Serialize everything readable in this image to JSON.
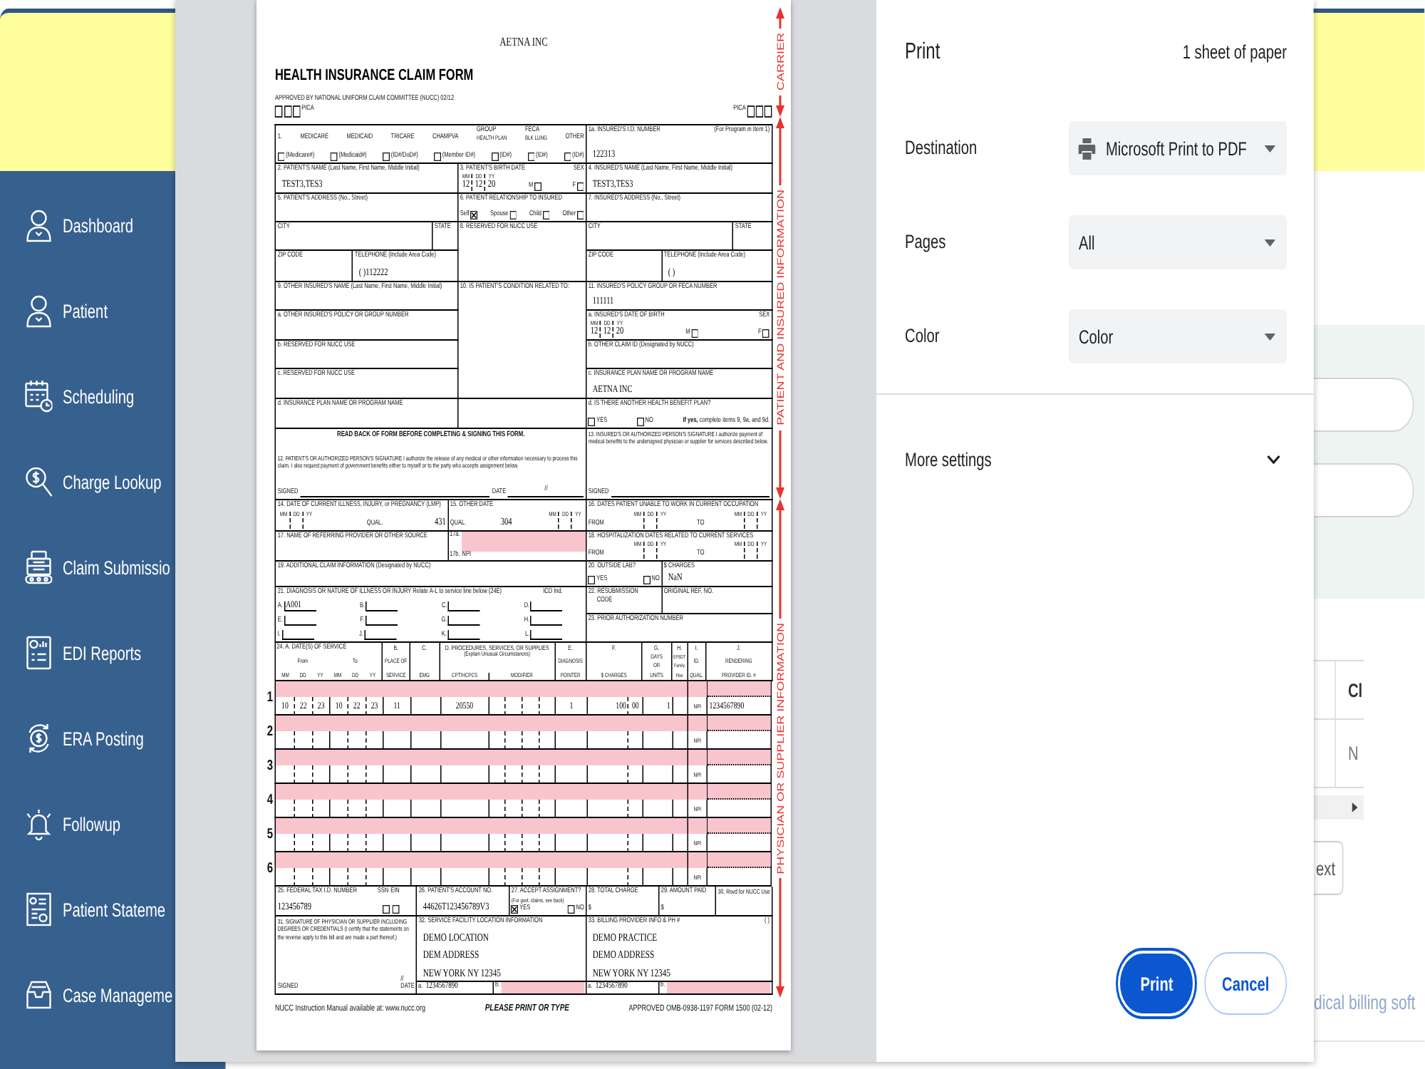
{
  "app": {
    "sidebar": [
      {
        "label": "Dashboard"
      },
      {
        "label": "Patient"
      },
      {
        "label": "Scheduling"
      },
      {
        "label": "Charge Lookup"
      },
      {
        "label": "Claim Submissio"
      },
      {
        "label": "EDI Reports"
      },
      {
        "label": "ERA Posting"
      },
      {
        "label": "Followup"
      },
      {
        "label": "Patient Stateme"
      },
      {
        "label": "Case Manageme"
      }
    ],
    "page": {
      "table_header": "Cl",
      "table_cell": "N",
      "button": "ext",
      "footer": "dical billing soft"
    }
  },
  "print_dialog": {
    "preview": {
      "payer": "AETNA INC",
      "title": "HEALTH INSURANCE CLAIM FORM",
      "approval": "APPROVED BY NATIONAL UNIFORM CLAIM COMMITTEE (NUCC) 02/12",
      "pica": [
        {
          "label": "PICA",
          "boxes": [
            {
              "checked": false
            },
            {
              "checked": false
            },
            {
              "checked": false
            }
          ]
        },
        {
          "label": "PICA",
          "boxes": [
            {
              "checked": false
            },
            {
              "checked": false
            },
            {
              "checked": false
            }
          ]
        }
      ],
      "upper": [
        {
          "lines": [
            [
              {
                "kind": "caption",
                "text": "1."
              },
              {
                "kind": "caption",
                "text": "MEDICARE"
              },
              {
                "kind": "caption",
                "text": "MEDICAID"
              },
              {
                "kind": "caption",
                "text": "TRICARE"
              },
              {
                "kind": "caption",
                "text": "CHAMPVA"
              },
              {
                "kind": "caption",
                "text": "GROUP",
                "sub": "HEALTH PLAN"
              },
              {
                "kind": "caption",
                "text": "FECA",
                "sub": "BLK LUNG"
              },
              {
                "kind": "caption",
                "text": "OTHER"
              }
            ],
            [
              {
                "kind": "check",
                "checked": false,
                "label": "(Medicare#)"
              },
              {
                "kind": "check",
                "checked": false,
                "label": "(Medicaid#)"
              },
              {
                "kind": "check",
                "checked": false,
                "label": "(ID#/DoD#)"
              },
              {
                "kind": "check",
                "checked": false,
                "label": "(Member ID#)"
              },
              {
                "kind": "check",
                "checked": false,
                "label": "(ID#)"
              },
              {
                "kind": "check",
                "checked": false,
                "label": "(ID#)"
              },
              {
                "kind": "check",
                "checked": false,
                "label": "(ID#)"
              }
            ]
          ]
        },
        {
          "lines": [
            [
              {
                "kind": "caption",
                "text": "1a. INSURED'S I.D. NUMBER"
              },
              {
                "kind": "caption",
                "text": "(For Program in Item 1)"
              }
            ],
            [
              {
                "kind": "value",
                "text": "122313"
              }
            ]
          ]
        },
        {
          "lines": [
            [
              {
                "kind": "caption",
                "text": "2. PATIENT'S NAME (Last Name, First Name, Middle Initial)"
              }
            ],
            [
              {
                "kind": "value",
                "text": "TEST3,TES3"
              }
            ]
          ]
        },
        {
          "lines": [
            [
              {
                "kind": "caption",
                "text": "3. PATIENT'S BIRTH DATE"
              },
              {
                "kind": "caption",
                "text": "SEX"
              }
            ],
            [
              {
                "kind": "date",
                "parts": [
                  {
                    "unit": "MM",
                    "value": "12"
                  },
                  {
                    "unit": "DD",
                    "value": "12"
                  },
                  {
                    "unit": "YY",
                    "value": "20"
                  }
                ]
              },
              {
                "kind": "check",
                "checked": false,
                "prefix": "M"
              },
              {
                "kind": "check",
                "checked": false,
                "prefix": "F"
              }
            ]
          ]
        },
        {
          "lines": [
            [
              {
                "kind": "caption",
                "text": "4. INSURED'S NAME (Last Name, First Name, Middle Initial)"
              }
            ],
            [
              {
                "kind": "value",
                "text": "TEST3,TES3"
              }
            ]
          ]
        },
        {
          "lines": [
            [
              {
                "kind": "caption",
                "text": "5. PATIENT'S ADDRESS (No., Street)"
              }
            ]
          ]
        },
        {
          "lines": [
            [
              {
                "kind": "caption",
                "text": "6. PATIENT RELATIONSHIP TO INSURED"
              }
            ],
            [
              {
                "kind": "check",
                "checked": true,
                "prefix": "Self"
              },
              {
                "kind": "check",
                "checked": false,
                "prefix": "Spouse"
              },
              {
                "kind": "check",
                "checked": false,
                "prefix": "Child"
              },
              {
                "kind": "check",
                "checked": false,
                "prefix": "Other"
              }
            ]
          ]
        },
        {
          "lines": [
            [
              {
                "kind": "caption",
                "text": "7. INSURED'S ADDRESS (No., Street)"
              }
            ]
          ]
        },
        {
          "lines": [
            [
              {
                "kind": "caption",
                "text": "CITY"
              }
            ]
          ]
        },
        {
          "lines": [
            [
              {
                "kind": "caption",
                "text": "STATE"
              }
            ]
          ]
        },
        {
          "lines": [
            [
              {
                "kind": "caption",
                "text": "8. RESERVED FOR NUCC USE"
              }
            ]
          ]
        },
        {
          "lines": [
            [
              {
                "kind": "caption",
                "text": "CITY"
              }
            ]
          ]
        },
        {
          "lines": [
            [
              {
                "kind": "caption",
                "text": "STATE"
              }
            ]
          ]
        },
        {
          "lines": [
            [
              {
                "kind": "caption",
                "text": "ZIP CODE"
              }
            ]
          ]
        },
        {
          "lines": [
            [
              {
                "kind": "caption",
                "text": "TELEPHONE (Include Area Code)"
              }
            ],
            [
              {
                "kind": "value",
                "text": "( )112222"
              }
            ]
          ]
        },
        {
          "lines": [
            [
              {
                "kind": "caption",
                "text": "ZIP CODE"
              }
            ]
          ]
        },
        {
          "lines": [
            [
              {
                "kind": "caption",
                "text": "TELEPHONE (Include Area Code)"
              }
            ],
            [
              {
                "kind": "value",
                "text": "( )"
              }
            ]
          ]
        },
        {
          "lines": [
            [
              {
                "kind": "caption",
                "text": "9. OTHER INSURED'S NAME (Last Name, First Name, Middle Initial)"
              }
            ]
          ]
        },
        {
          "lines": [
            [
              {
                "kind": "caption",
                "text": "10. IS PATIENT'S CONDITION RELATED TO:"
              }
            ]
          ]
        },
        {
          "lines": [
            [
              {
                "kind": "caption",
                "text": "11. INSURED'S POLICY GROUP OR FECA NUMBER"
              }
            ],
            [
              {
                "kind": "value",
                "text": "111111"
              }
            ]
          ]
        },
        {
          "lines": [
            [
              {
                "kind": "caption",
                "text": "a. OTHER INSURED'S POLICY OR GROUP NUMBER"
              }
            ]
          ]
        },
        {
          "lines": [
            [
              {
                "kind": "caption",
                "text": "a. INSURED'S DATE OF BIRTH"
              },
              {
                "kind": "caption",
                "text": "SEX"
              }
            ],
            [
              {
                "kind": "date",
                "parts": [
                  {
                    "unit": "MM",
                    "value": "12"
                  },
                  {
                    "unit": "DD",
                    "value": "12"
                  },
                  {
                    "unit": "YY",
                    "value": "20"
                  }
                ]
              },
              {
                "kind": "check",
                "checked": false,
                "prefix": "M"
              },
              {
                "kind": "check",
                "checked": false,
                "prefix": "F"
              }
            ]
          ]
        },
        {
          "lines": [
            [
              {
                "kind": "caption",
                "text": "b. RESERVED FOR NUCC USE"
              }
            ]
          ]
        },
        {
          "lines": [
            [
              {
                "kind": "caption",
                "text": "b. OTHER CLAIM ID (Designated by NUCC)"
              }
            ]
          ]
        },
        {
          "lines": [
            [
              {
                "kind": "caption",
                "text": "c. RESERVED FOR NUCC USE"
              }
            ]
          ]
        },
        {
          "lines": [
            [
              {
                "kind": "caption",
                "text": "c. INSURANCE PLAN NAME OR PROGRAM NAME"
              }
            ],
            [
              {
                "kind": "value",
                "text": "AETNA INC"
              }
            ]
          ]
        },
        {
          "lines": [
            [
              {
                "kind": "caption",
                "text": "d. INSURANCE PLAN NAME OR PROGRAM NAME"
              }
            ]
          ]
        },
        {
          "lines": [
            [
              {
                "kind": "caption",
                "text": "d. IS THERE ANOTHER HEALTH BENEFIT PLAN?"
              }
            ],
            [
              {
                "kind": "check",
                "checked": false,
                "label": "YES"
              },
              {
                "kind": "check",
                "checked": false,
                "label": "NO"
              },
              {
                "kind": "caption",
                "text": "**If yes,** complete items 9, 9a, and 9d."
              }
            ]
          ]
        },
        {
          "lines": [
            [
              {
                "kind": "heading",
                "text": "READ BACK OF FORM BEFORE COMPLETING & SIGNING THIS FORM."
              }
            ],
            [
              {
                "kind": "para",
                "text": "12. PATIENT'S OR AUTHORIZED PERSON'S SIGNATURE I authorize the release of any medical or other information necessary to process this claim. I also request payment of government benefits either to myself or to the party who accepts assignment below."
              }
            ],
            [
              {
                "kind": "caption",
                "text": "SIGNED"
              },
              {
                "kind": "blank"
              },
              {
                "kind": "caption",
                "text": "DATE"
              },
              {
                "kind": "blank",
                "value": "//"
              }
            ]
          ]
        },
        {
          "lines": [
            [
              {
                "kind": "para",
                "text": "13. INSURED'S OR AUTHORIZED PERSON'S SIGNATURE I authorize payment of medical benefits to the undersigned physician or supplier for services described below."
              }
            ],
            [
              {
                "kind": "caption",
                "text": "SIGNED"
              },
              {
                "kind": "blank"
              }
            ]
          ]
        },
        {
          "lines": [
            [
              {
                "kind": "caption",
                "text": "14. DATE OF CURRENT ILLNESS, INJURY, or PREGNANCY (LMP)"
              }
            ],
            [
              {
                "kind": "date",
                "parts": [
                  {
                    "unit": "MM"
                  },
                  {
                    "unit": "DD"
                  },
                  {
                    "unit": "YY"
                  }
                ]
              },
              {
                "kind": "caption",
                "text": "QUAL."
              },
              {
                "kind": "value",
                "text": "431"
              }
            ]
          ]
        },
        {
          "lines": [
            [
              {
                "kind": "caption",
                "text": "15. OTHER DATE"
              }
            ],
            [
              {
                "kind": "caption",
                "text": "QUAL."
              },
              {
                "kind": "value",
                "text": "304"
              },
              {
                "kind": "date",
                "parts": [
                  {
                    "unit": "MM"
                  },
                  {
                    "unit": "DD"
                  },
                  {
                    "unit": "YY"
                  }
                ]
              }
            ]
          ]
        },
        {
          "lines": [
            [
              {
                "kind": "caption",
                "text": "16. DATES PATIENT UNABLE TO WORK IN CURRENT OCCUPATION"
              }
            ],
            [
              {
                "kind": "caption",
                "text": "FROM"
              },
              {
                "kind": "date",
                "parts": [
                  {
                    "unit": "MM"
                  },
                  {
                    "unit": "DD"
                  },
                  {
                    "unit": "YY"
                  }
                ]
              },
              {
                "kind": "caption",
                "text": "TO"
              },
              {
                "kind": "date",
                "parts": [
                  {
                    "unit": "MM"
                  },
                  {
                    "unit": "DD"
                  },
                  {
                    "unit": "YY"
                  }
                ]
              }
            ]
          ]
        },
        {
          "lines": [
            [
              {
                "kind": "caption",
                "text": "17. NAME OF REFERRING PROVIDER OR OTHER SOURCE"
              }
            ]
          ]
        },
        {
          "lines": [
            [
              {
                "kind": "caption",
                "text": "17a."
              },
              {
                "kind": "shade"
              }
            ],
            [
              {
                "kind": "caption",
                "text": "17b."
              },
              {
                "kind": "caption",
                "text": "NPI"
              }
            ]
          ]
        },
        {
          "lines": [
            [
              {
                "kind": "caption",
                "text": "18. HOSPITALIZATION DATES RELATED TO CURRENT SERVICES"
              }
            ],
            [
              {
                "kind": "caption",
                "text": "FROM"
              },
              {
                "kind": "date",
                "parts": [
                  {
                    "unit": "MM"
                  },
                  {
                    "unit": "DD"
                  },
                  {
                    "unit": "YY"
                  }
                ]
              },
              {
                "kind": "caption",
                "text": "TO"
              },
              {
                "kind": "date",
                "parts": [
                  {
                    "unit": "MM"
                  },
                  {
                    "unit": "DD"
                  },
                  {
                    "unit": "YY"
                  }
                ]
              }
            ]
          ]
        },
        {
          "lines": [
            [
              {
                "kind": "caption",
                "text": "19. ADDITIONAL CLAIM INFORMATION (Designated by NUCC)"
              }
            ]
          ]
        },
        {
          "lines": [
            [
              {
                "kind": "caption",
                "text": "20. OUTSIDE LAB?"
              }
            ],
            [
              {
                "kind": "check",
                "checked": false,
                "label": "YES"
              },
              {
                "kind": "check",
                "checked": false,
                "label": "NO"
              }
            ]
          ]
        },
        {
          "lines": [
            [
              {
                "kind": "caption",
                "text": "$ CHARGES"
              }
            ],
            [
              {
                "kind": "value",
                "text": "NaN"
              }
            ]
          ]
        },
        {
          "lines": [
            [
              {
                "kind": "caption",
                "text": "21. DIAGNOSIS OR NATURE OF ILLNESS OR INJURY Relate A-L to service line below (24E)"
              },
              {
                "kind": "caption",
                "text": "ICD Ind."
              }
            ],
            [
              {
                "kind": "diag",
                "letter": "A.",
                "value": "A001"
              },
              {
                "kind": "diag",
                "letter": "B."
              },
              {
                "kind": "diag",
                "letter": "C."
              },
              {
                "kind": "diag",
                "letter": "D."
              }
            ],
            [
              {
                "kind": "diag",
                "letter": "E."
              },
              {
                "kind": "diag",
                "letter": "F."
              },
              {
                "kind": "diag",
                "letter": "G."
              },
              {
                "kind": "diag",
                "letter": "H."
              }
            ],
            [
              {
                "kind": "diag",
                "letter": "I."
              },
              {
                "kind": "diag",
                "letter": "J."
              },
              {
                "kind": "diag",
                "letter": "K."
              },
              {
                "kind": "diag",
                "letter": "L."
              }
            ]
          ]
        },
        {
          "lines": [
            [
              {
                "kind": "caption",
                "text": "22. RESUBMISSION"
              }
            ],
            [
              {
                "kind": "caption",
                "text": "CODE"
              }
            ]
          ]
        },
        {
          "lines": [
            [
              {
                "kind": "caption",
                "text": "ORIGINAL REF. NO."
              }
            ]
          ]
        },
        {
          "lines": [
            [
              {
                "kind": "caption",
                "text": "23. PRIOR AUTHORIZATION NUMBER"
              }
            ]
          ]
        }
      ],
      "service_header": {
        "date": {
          "title": "24. A. DATE(S) OF SERVICE",
          "from": "From",
          "to": "To",
          "units": [
            "MM",
            "DD",
            "YY",
            "MM",
            "DD",
            "YY"
          ]
        },
        "columns": [
          {
            "lines": [
              "B.",
              "PLACE OF",
              "SERVICE"
            ]
          },
          {
            "lines": [
              "C.",
              "EMG"
            ]
          },
          {
            "lines": [
              "D. PROCEDURES, SERVICES, OR SUPPLIES",
              "(Explain Unusual Circumstances)"
            ],
            "subs": [
              "CPT/HCPCS",
              "MODIFIER"
            ]
          },
          {
            "lines": [
              "E.",
              "DIAGNOSIS",
              "POINTER"
            ]
          },
          {
            "lines": [
              "F.",
              "$ CHARGES"
            ]
          },
          {
            "lines": [
              "G.",
              "DAYS",
              "OR",
              "UNITS"
            ]
          },
          {
            "lines": [
              "H.",
              "EPSDT",
              "Family",
              "Plan"
            ]
          },
          {
            "lines": [
              "I.",
              "ID.",
              "QUAL."
            ]
          },
          {
            "lines": [
              "J.",
              "RENDERING",
              "PROVIDER ID. #"
            ]
          }
        ]
      },
      "service_lines": [
        {
          "number": "1",
          "from": [
            "10",
            "22",
            "23"
          ],
          "to": [
            "10",
            "22",
            "23"
          ],
          "place": "11",
          "cpt": "20550",
          "pointer": "1",
          "charges": [
            "100",
            "00"
          ],
          "units": "1",
          "qual": "NPI",
          "provider": "1234567890"
        },
        {
          "number": "2",
          "qual": "NPI"
        },
        {
          "number": "3",
          "qual": "NPI"
        },
        {
          "number": "4",
          "qual": "NPI"
        },
        {
          "number": "5",
          "qual": "NPI"
        },
        {
          "number": "6",
          "qual": "NPI"
        }
      ],
      "lower": [
        {
          "lines": [
            [
              {
                "kind": "caption",
                "text": "25. FEDERAL TAX I.D. NUMBER"
              },
              {
                "kind": "caption",
                "text": "SSN"
              },
              {
                "kind": "caption",
                "text": "EIN"
              }
            ],
            [
              {
                "kind": "value",
                "text": "123456789"
              },
              {
                "kind": "check",
                "checked": false
              },
              {
                "kind": "check",
                "checked": false
              }
            ]
          ]
        },
        {
          "lines": [
            [
              {
                "kind": "caption",
                "text": "26. PATIENT'S ACCOUNT NO."
              }
            ],
            [
              {
                "kind": "value",
                "text": "44626T123456789V3"
              }
            ]
          ]
        },
        {
          "lines": [
            [
              {
                "kind": "caption",
                "text": "27. ACCEPT ASSIGNMENT?"
              }
            ],
            [
              {
                "kind": "caption",
                "text": "(For govt. claims, see back)"
              }
            ],
            [
              {
                "kind": "check",
                "checked": true,
                "label": "YES"
              },
              {
                "kind": "check",
                "checked": false,
                "label": "NO"
              }
            ]
          ]
        },
        {
          "lines": [
            [
              {
                "kind": "caption",
                "text": "28. TOTAL CHARGE"
              }
            ],
            [
              {
                "kind": "caption",
                "text": "$"
              }
            ]
          ]
        },
        {
          "lines": [
            [
              {
                "kind": "caption",
                "text": "29. AMOUNT PAID"
              }
            ],
            [
              {
                "kind": "caption",
                "text": "$"
              }
            ]
          ]
        },
        {
          "lines": [
            [
              {
                "kind": "caption",
                "text": "30. Rsvd for NUCC Use"
              }
            ]
          ]
        },
        {
          "lines": [
            [
              {
                "kind": "para",
                "text": "31. SIGNATURE OF PHYSICIAN OR SUPPLIER INCLUDING DEGREES OR CREDENTIALS (I certify that the statements on the reverse apply to this bill and are made a part thereof.)"
              }
            ],
            [
              {
                "kind": "caption",
                "text": "SIGNED"
              },
              {
                "kind": "caption",
                "text": "DATE",
                "above": "//"
              }
            ]
          ]
        },
        {
          "lines": [
            [
              {
                "kind": "caption",
                "text": "32. SERVICE FACILITY LOCATION INFORMATION"
              }
            ],
            [
              {
                "kind": "value",
                "text": "DEMO LOCATION"
              }
            ],
            [
              {
                "kind": "value",
                "text": "DEM ADDRESS"
              }
            ],
            [
              {
                "kind": "value",
                "text": "NEW YORK NY 12345"
              }
            ]
          ]
        },
        {
          "lines": [
            [
              {
                "kind": "caption",
                "text": "33. BILLING PROVIDER INFO & PH #"
              },
              {
                "kind": "caption",
                "text": "( )"
              }
            ],
            [
              {
                "kind": "value",
                "text": "DEMO PRACTICE"
              }
            ],
            [
              {
                "kind": "value",
                "text": "DEMO ADDRESS"
              }
            ],
            [
              {
                "kind": "value",
                "text": "NEW YORK NY 12345"
              }
            ]
          ]
        },
        {
          "lines": [
            [
              {
                "kind": "caption",
                "text": "a."
              },
              {
                "kind": "value",
                "text": "1234567890"
              }
            ]
          ]
        },
        {
          "lines": [
            [
              {
                "kind": "caption",
                "text": "b."
              },
              {
                "kind": "shade"
              }
            ]
          ]
        },
        {
          "lines": [
            [
              {
                "kind": "caption",
                "text": "a."
              },
              {
                "kind": "value",
                "text": "1234567890"
              }
            ]
          ]
        },
        {
          "lines": [
            [
              {
                "kind": "caption",
                "text": "b."
              },
              {
                "kind": "shade"
              }
            ]
          ]
        }
      ],
      "footer": [
        "NUCC Instruction Manual available at: www.nucc.org",
        "PLEASE PRINT OR TYPE",
        "APPROVED OMB-0938-1197 FORM 1500 (02-12)"
      ],
      "side_labels": [
        "CARRIER",
        "PATIENT AND INSURED INFORMATION",
        "PHYSICIAN OR SUPPLIER INFORMATION"
      ]
    },
    "title": "Print",
    "sheets": "1 sheet of paper",
    "settings": [
      {
        "label": "Destination",
        "value": "Microsoft Print to PDF",
        "kind": "printer"
      },
      {
        "label": "Pages",
        "value": "All",
        "kind": "select"
      },
      {
        "label": "Color",
        "value": "Color",
        "kind": "select"
      }
    ],
    "more_settings": "More settings",
    "buttons": [
      {
        "label": "Print",
        "kind": "primary"
      },
      {
        "label": "Cancel",
        "kind": "secondary"
      }
    ]
  }
}
